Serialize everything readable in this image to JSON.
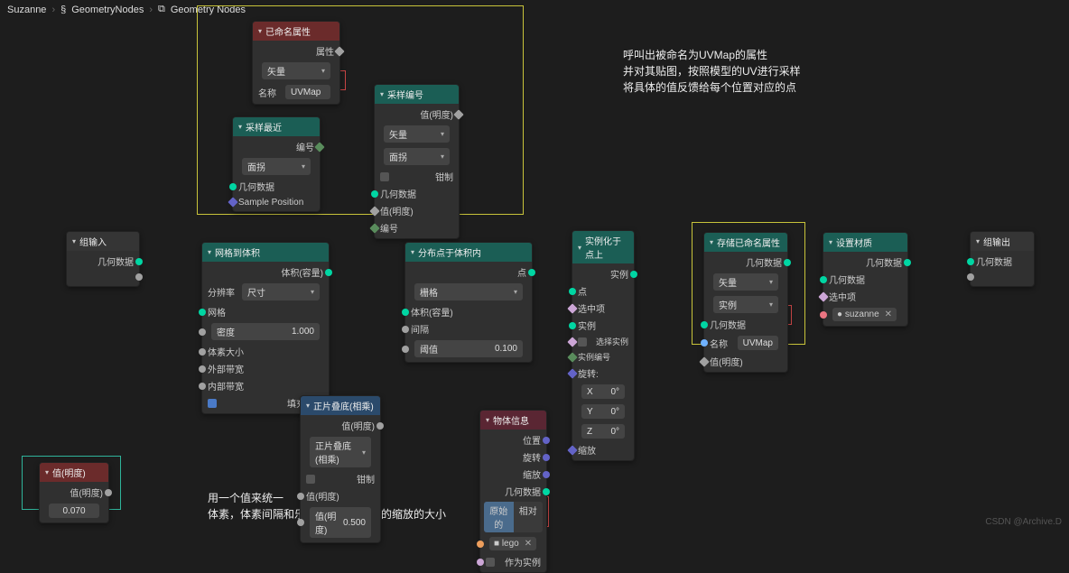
{
  "breadcrumb": {
    "obj": "Suzanne",
    "group": "GeometryNodes",
    "tree": "Geometry Nodes"
  },
  "nodes": {
    "group_input": {
      "title": "组输入",
      "out_geom": "几何数据"
    },
    "named_attr": {
      "title": "已命名属性",
      "out_attr": "属性",
      "type_label": "矢量",
      "name_label": "名称",
      "name_val": "UVMap"
    },
    "sample_index": {
      "title": "采样编号",
      "out_val": "值(明度)",
      "type_label": "矢量",
      "domain_label": "面拐",
      "clamp_label": "钳制",
      "in_geom": "几何数据",
      "in_val": "值(明度)",
      "in_index": "编号"
    },
    "sample_nearest": {
      "title": "采样最近",
      "out_index": "编号",
      "domain_label": "面拐",
      "in_geom": "几何数据",
      "in_pos": "Sample Position"
    },
    "mesh_to_vol": {
      "title": "网格到体积",
      "out_vol": "体积(容量)",
      "res_label": "分辨率",
      "res_mode": "尺寸",
      "in_mesh": "网格",
      "density_label": "密度",
      "density_val": "1.000",
      "voxel_label": "体素大小",
      "ext_label": "外部带宽",
      "int_label": "内部带宽",
      "fill_label": "填充体积"
    },
    "dist_pts": {
      "title": "分布点于体积内",
      "out_pts": "点",
      "mode_label": "栅格",
      "in_vol": "体积(容量)",
      "in_seed": "间隔",
      "thresh_label": "阈值",
      "thresh_val": "0.100"
    },
    "inst_on_pts": {
      "title": "实例化于点上",
      "out_inst": "实例",
      "in_pts": "点",
      "sel_label": "选中项",
      "in_inst": "实例",
      "pick_label": "选择实例",
      "idx_label": "实例编号",
      "rot_label": "旋转:",
      "rx": "X",
      "ry": "Y",
      "rz": "Z",
      "r0": "0°",
      "scale_label": "缩放"
    },
    "store_attr": {
      "title": "存储已命名属性",
      "out_geom": "几何数据",
      "type_label": "矢量",
      "domain_label": "实例",
      "in_geom": "几何数据",
      "name_label": "名称",
      "name_val": "UVMap",
      "in_val": "值(明度)"
    },
    "set_mat": {
      "title": "设置材质",
      "out_geom": "几何数据",
      "in_geom": "几何数据",
      "sel_label": "选中项",
      "mat_val": "suzanne"
    },
    "group_output": {
      "title": "组输出",
      "in_geom": "几何数据"
    },
    "value": {
      "title": "值(明度)",
      "out_label": "值(明度)",
      "val": "0.070"
    },
    "multiply": {
      "title": "正片叠底(相乘)",
      "out_val": "值(明度)",
      "mode_label": "正片叠底(相乘)",
      "clamp_label": "钳制",
      "in_val": "值(明度)",
      "fac_label": "值(明度)",
      "fac_val": "0.500"
    },
    "obj_info": {
      "title": "物体信息",
      "out_loc": "位置",
      "out_rot": "旋转",
      "out_scale": "缩放",
      "out_geom": "几何数据",
      "tab_orig": "原始的",
      "tab_rel": "相对",
      "obj_val": "lego",
      "as_inst": "作为实例"
    }
  },
  "annotations": {
    "top_l1": "呼叫出被命名为UVMap的属性",
    "top_l2": "并对其贴图，按照模型的UV进行采样",
    "top_l3": "将具体的值反馈给每个位置对应的点",
    "bot_l1": "用一个值来统一",
    "bot_l2": "体素，体素间隔和乐高模型对应比例的缩放的大小"
  },
  "watermark": "CSDN @Archive.D"
}
